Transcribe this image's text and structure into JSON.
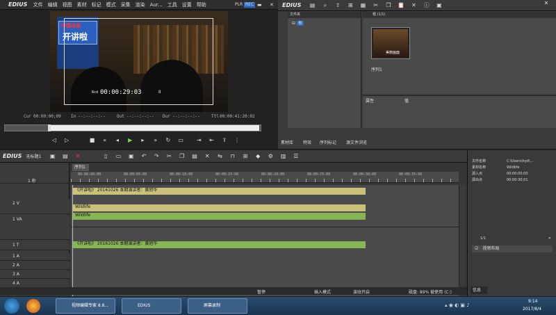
{
  "menubar": {
    "app": "EDIUS",
    "items": [
      "文件",
      "编辑",
      "视图",
      "素材",
      "标记",
      "模式",
      "采集",
      "渲染",
      "Aur...",
      "工具",
      "设置",
      "帮助"
    ],
    "plr": "PLR",
    "rec": "REC"
  },
  "player": {
    "overlay_top": "中国动画",
    "overlay_show": "开讲啦",
    "overlay_tc_label": "Rcd",
    "overlay_tc": "00:00:29:03",
    "overlay_tc_flag": "II",
    "cur_label": "Cur",
    "cur_value": "00:00:00;09",
    "in_label": "In",
    "in_value": "--:--:--:--",
    "out_label": "Out",
    "out_value": "--:--:--:--",
    "dur_label": "Dur",
    "dur_value": "--:--:--:--",
    "ttl_label": "Ttl",
    "ttl_value": "00:00:41:20:02"
  },
  "bin": {
    "app": "EDIUS",
    "folder_header": "文件夹",
    "root_label": "根",
    "clip_header": "根 (1/1)",
    "clip_name": "序列1",
    "clip_thumb_text": "美丽画面",
    "props_col1": "属性",
    "props_col2": "值",
    "tabs": [
      "素材库",
      "特效",
      "序列标记",
      "源文件浏览"
    ]
  },
  "timeline": {
    "app": "EDIUS",
    "project": "无标题1",
    "seq_tab": "序列1",
    "scale": "1 秒",
    "ruler": [
      "00:00:00:00",
      "00:00:05:00",
      "00:00:10:00",
      "00:00:15:00",
      "00:00:20:00",
      "00:00:25:00",
      "00:00:30:00",
      "00:00:35:00"
    ],
    "tracks": [
      {
        "label": "2 V",
        "type": "video"
      },
      {
        "label": "1 VA",
        "type": "va"
      },
      {
        "label": "1 T",
        "type": "title"
      },
      {
        "label": "1 A",
        "type": "audio"
      },
      {
        "label": "2 A",
        "type": "audio"
      },
      {
        "label": "3 A",
        "type": "audio"
      },
      {
        "label": "4 A",
        "type": "audio"
      }
    ],
    "clip_2v": "《开讲啦》 20161026 本期演讲者：黄旭华",
    "clip_1va_video": "Wildlife",
    "clip_1va_audio": "Wildlife",
    "clip_1t": "《开讲啦》 20161026 本期演讲者：黄旭华",
    "status": {
      "pause": "暂停",
      "insert": "插入模式",
      "ripple": "波纹开启",
      "disk": "磁盘: 89% 被使用 (C:)"
    }
  },
  "info_panel": {
    "rows": [
      {
        "k": "文件名称",
        "v": "C:\\Users\\hyd\\..."
      },
      {
        "k": "素材名称",
        "v": "Wildlife"
      },
      {
        "k": "源入点",
        "v": "00:00:00;00"
      },
      {
        "k": "源出点",
        "v": "00:00:30;01"
      }
    ],
    "fx_header": "1/1",
    "fx_item": "视频布局",
    "tab": "信息"
  },
  "taskbar": {
    "buttons": [
      "视频编辑专家 8.8...",
      "EDIUS",
      "屏幕录制"
    ],
    "time": "9:14",
    "date": "2017/8/4"
  }
}
